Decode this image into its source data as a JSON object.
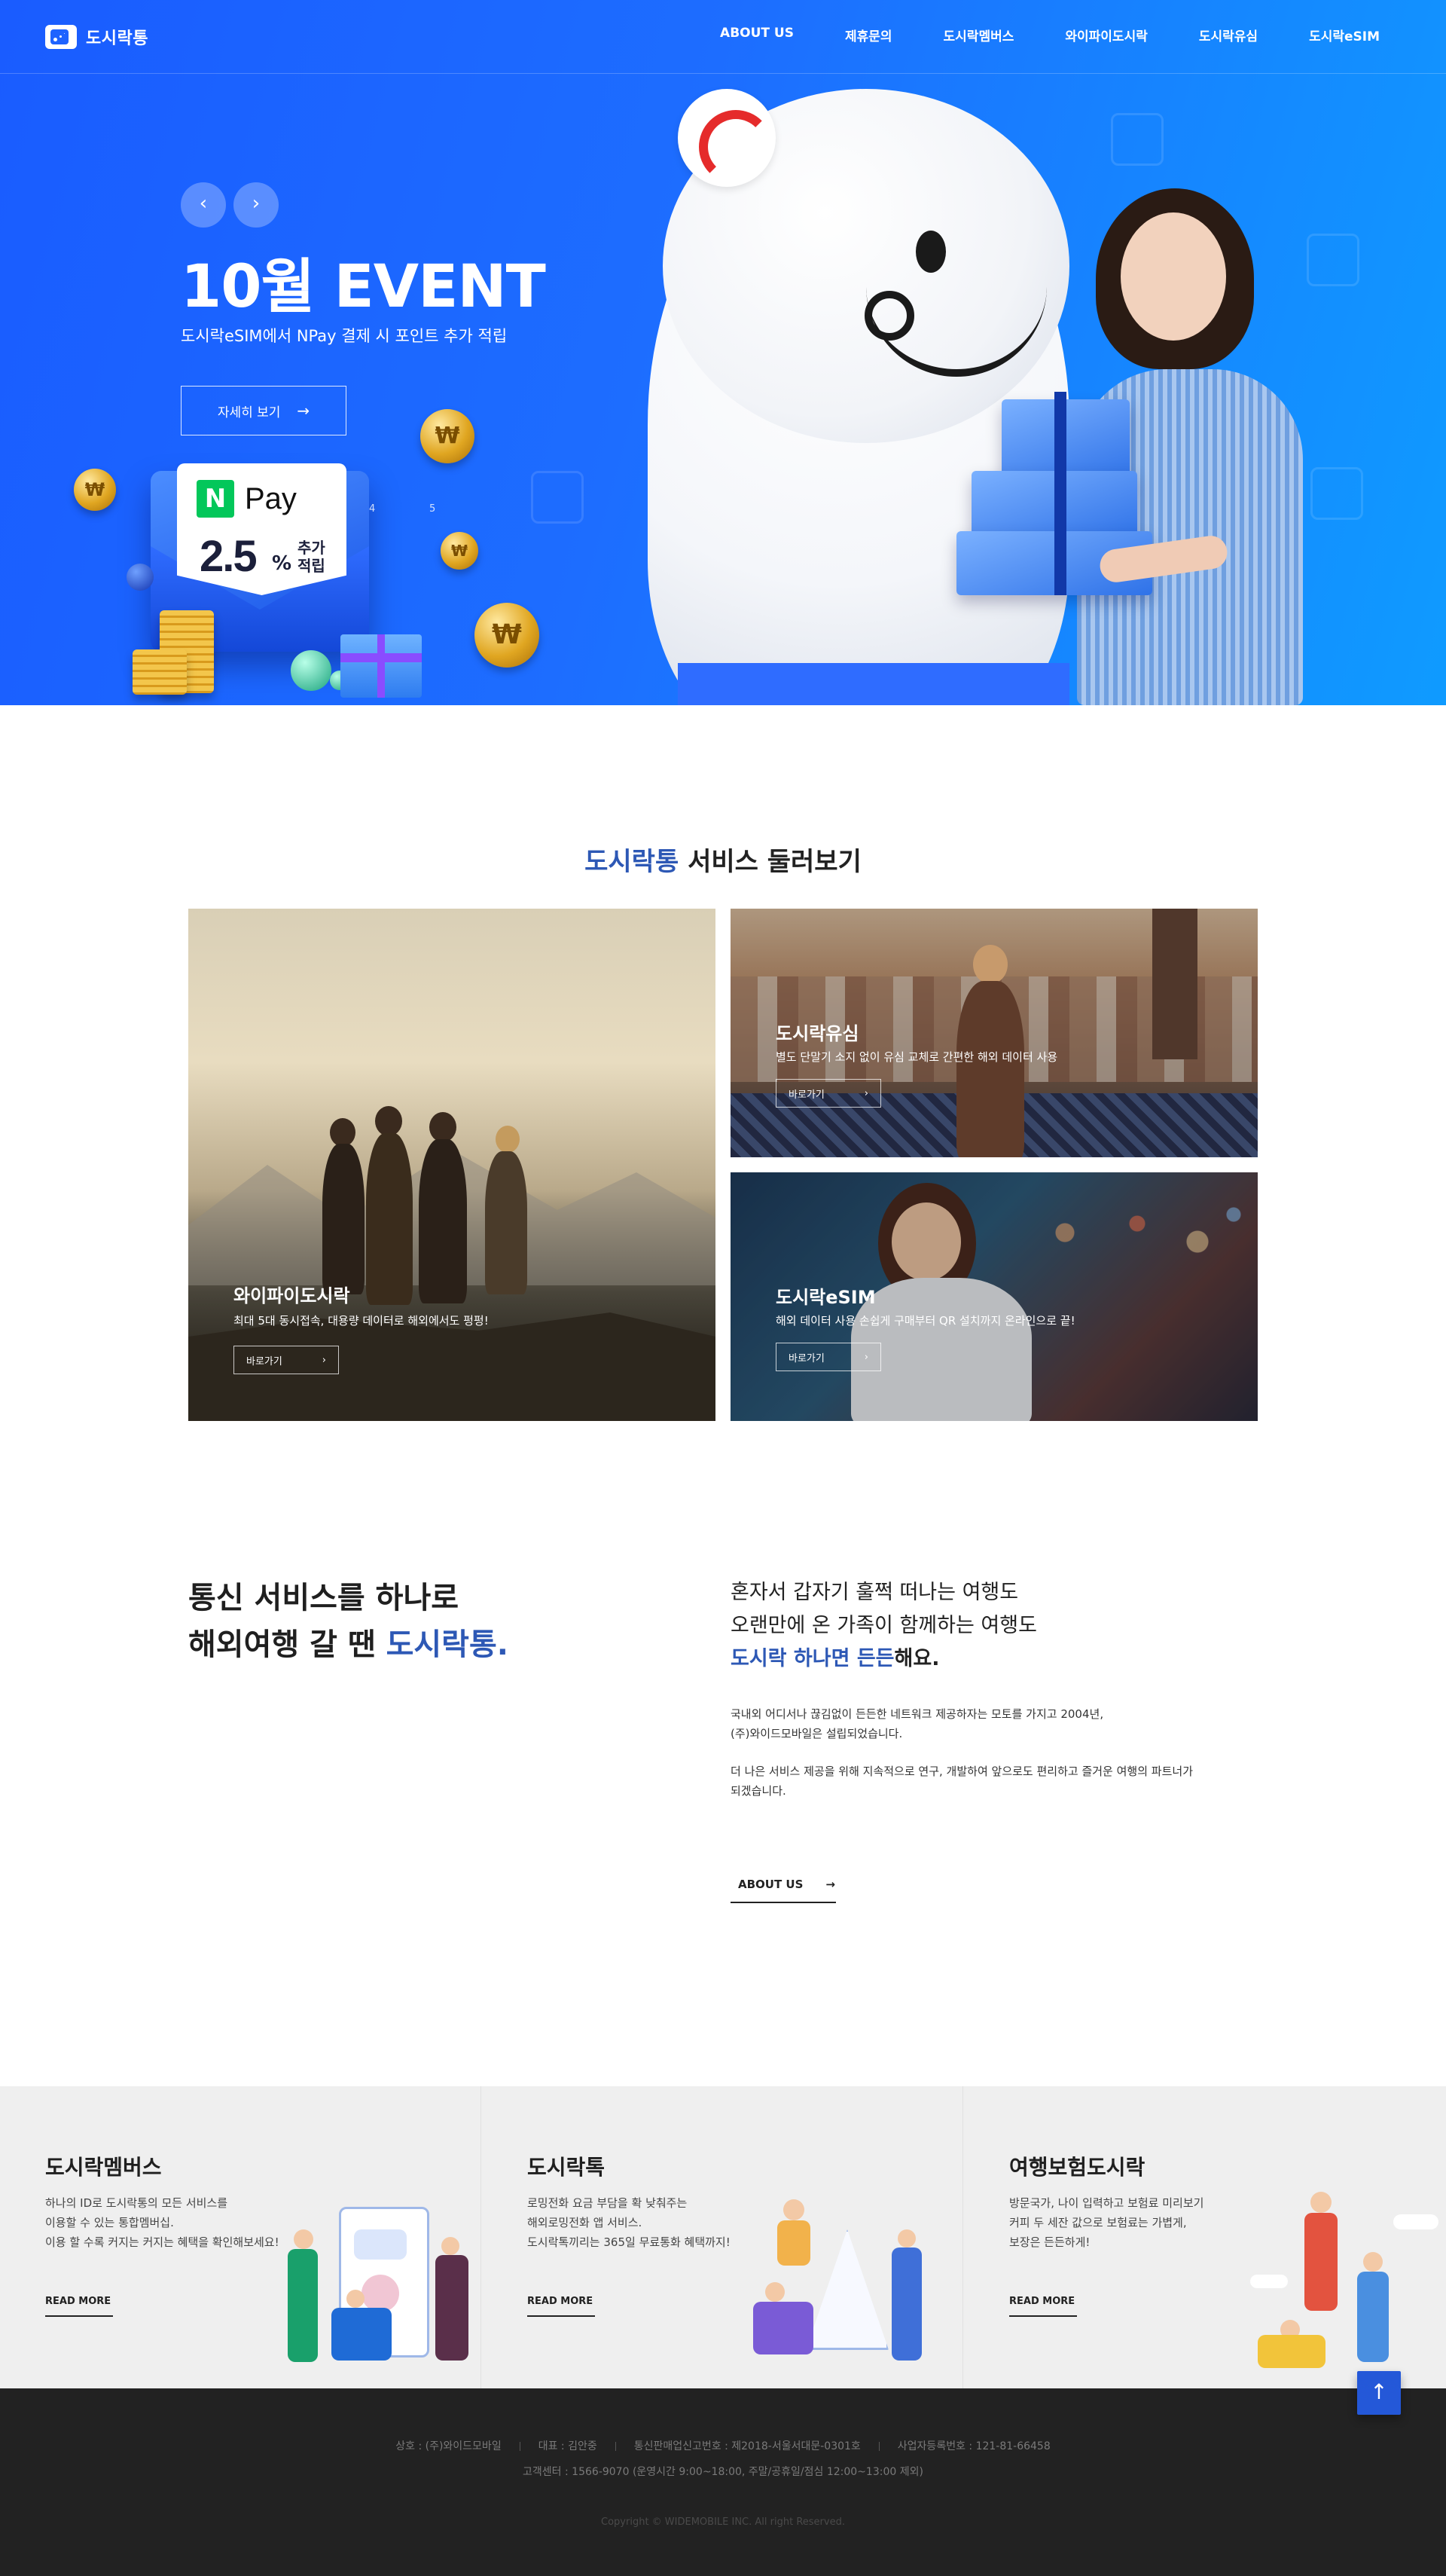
{
  "header": {
    "logo_text": "도시락통",
    "nav": [
      {
        "label": "ABOUT US"
      },
      {
        "label": "제휴문의"
      },
      {
        "label": "도시락멤버스"
      },
      {
        "label": "와이파이도시락"
      },
      {
        "label": "도시락유심"
      },
      {
        "label": "도시락eSIM"
      }
    ]
  },
  "hero": {
    "prev_arrow": "‹",
    "next_arrow": "›",
    "title": "10월 EVENT",
    "subtitle": "도시락eSIM에서 NPay 결제 시 포인트 추가 적립",
    "button_label": "자세히 보기",
    "button_arrow": "→",
    "npay": {
      "n_mark": "N",
      "brand": "Pay",
      "rate": "2.5",
      "percent": "%",
      "label_line1": "추가",
      "label_line2": "적립"
    },
    "coin_symbol": "₩",
    "card_numbers": [
      "4",
      "5"
    ],
    "accent_color": "#1d6dff"
  },
  "services": {
    "title_accent": "도시락통",
    "title_rest": " 서비스 둘러보기",
    "cards": [
      {
        "name": "와이파이도시락",
        "desc": "최대 5대 동시접속, 대용량 데이터로 해외에서도 펑펑!",
        "button": "바로가기"
      },
      {
        "name": "도시락유심",
        "desc": "별도 단말기 소지 없이 유심 교체로 간편한 해외 데이터 사용",
        "button": "바로가기"
      },
      {
        "name": "도시락eSIM",
        "desc": "해외 데이터 사용 손쉽게 구매부터 QR 설치까지 온라인으로 끝!",
        "button": "바로가기"
      }
    ],
    "button_arrow": "›"
  },
  "about": {
    "left_line1": "통신 서비스를 하나로",
    "left_line2_prefix": "해외여행 갈 땐 ",
    "left_line2_accent": "도시락통.",
    "right_line1": "혼자서 갑자기 훌쩍 떠나는 여행도",
    "right_line2": "오랜만에 온 가족이 함께하는 여행도",
    "right_line3_accent": "도시락 하나면 든든",
    "right_line3_tail": "해요.",
    "para1_line1": "국내외 어디서나 끊김없이 든든한 네트워크 제공하자는 모토를 가지고 2004년,",
    "para1_line2": "(주)와이드모바일은 설립되었습니다.",
    "para2_line1": "더 나은 서비스 제공을 위해 지속적으로 연구, 개발하여 앞으로도 편리하고 즐거운 여행의 파트너가",
    "para2_line2": "되겠습니다.",
    "link_label": "ABOUT US",
    "link_arrow": "→"
  },
  "columns": [
    {
      "title": "도시락멤버스",
      "lines": [
        "하나의 ID로 도시락통의 모든 서비스를",
        "이용할 수 있는 통합멤버십.",
        "이용 할 수록 커지는 커지는 혜택을 확인해보세요!"
      ],
      "readmore": "READ MORE"
    },
    {
      "title": "도시락톡",
      "lines": [
        "로밍전화 요금 부담을 확 낮춰주는",
        "해외로밍전화 앱 서비스.",
        "도시락톡끼리는 365일 무료통화 혜택까지!"
      ],
      "readmore": "READ MORE"
    },
    {
      "title": "여행보험도시락",
      "lines": [
        "방문국가, 나이 입력하고 보험료 미리보기",
        "커피 두 세잔 값으로 보험료는 가볍게,",
        "보장은 든든하게!"
      ],
      "readmore": "READ MORE"
    }
  ],
  "footer": {
    "info": [
      "상호 : (주)와이드모바일",
      "대표 : 김안중",
      "통신판매업신고번호 : 제2018-서울서대문-0301호",
      "사업자등록번호 : 121-81-66458"
    ],
    "service_center": "고객센터 : 1566-9070 (운영시간 9:00~18:00, 주말/공휴일/점심 12:00~13:00 제외)",
    "copyright": "Copyright © WIDEMOBILE INC. All right Reserved.",
    "top_arrow": "↑"
  }
}
